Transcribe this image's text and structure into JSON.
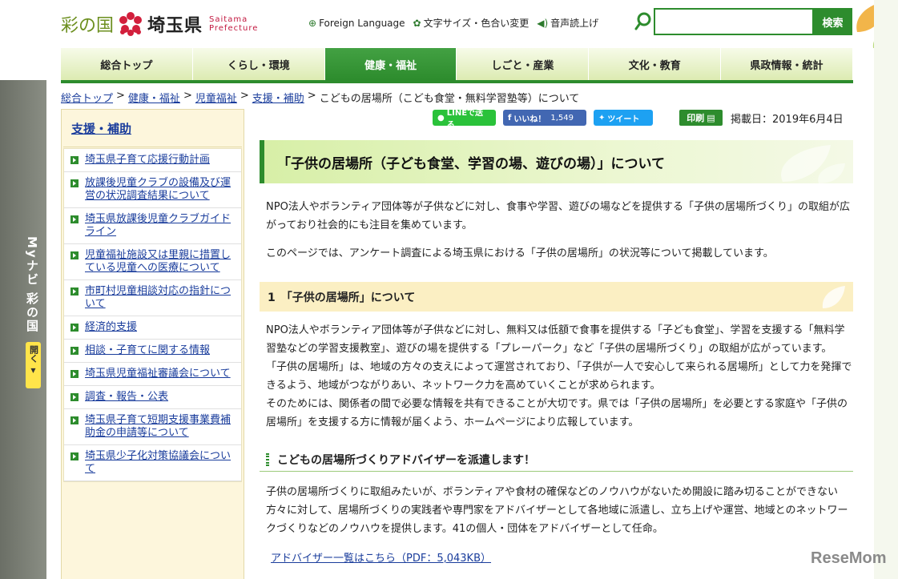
{
  "header": {
    "logo_irodori": "彩の国",
    "logo_pref": "埼玉県",
    "logo_en_line1": "Saitama",
    "logo_en_line2": "Prefecture",
    "util_links": [
      {
        "icon": "globe-icon",
        "label": "Foreign Language"
      },
      {
        "icon": "gear-icon",
        "label": "文字サイズ・色合い変更"
      },
      {
        "icon": "speaker-icon",
        "label": "音声読上げ"
      }
    ],
    "search_placeholder": "",
    "search_button": "検索"
  },
  "global_nav": [
    {
      "label": "総合トップ",
      "active": false
    },
    {
      "label": "くらし・環境",
      "active": false
    },
    {
      "label": "健康・福祉",
      "active": true
    },
    {
      "label": "しごと・産業",
      "active": false
    },
    {
      "label": "文化・教育",
      "active": false
    },
    {
      "label": "県政情報・統計",
      "active": false
    }
  ],
  "breadcrumb": {
    "links": [
      "総合トップ",
      "健康・福祉",
      "児童福祉",
      "支援・補助"
    ],
    "separator": ">",
    "current": "こどもの居場所（こども食堂・無料学習塾等）について"
  },
  "social": {
    "line": "LINEで送る",
    "like": "いいね！",
    "like_count": "1,549",
    "tweet": "ツイート",
    "print": "印刷",
    "pub_date": "掲載日：2019年6月4日"
  },
  "left_tab": {
    "label": "Myナビ 彩の国",
    "open": "開く"
  },
  "sidebar": {
    "title": "支援・補助",
    "items": [
      "埼玉県子育て応援行動計画",
      "放課後児童クラブの設備及び運営の状況調査結果について",
      "埼玉県放課後児童クラブガイドライン",
      "児童福祉施設又は里親に措置している児童への医療について",
      "市町村児童相談対応の指針について",
      "経済的支援",
      "相談・子育てに関する情報",
      "埼玉県児童福祉審議会について",
      "調査・報告・公表",
      "埼玉県子育て短期支援事業費補助金の申請等について",
      "埼玉県少子化対策協議会について"
    ]
  },
  "main": {
    "title": "「子供の居場所（子ども食堂、学習の場、遊びの場）」について",
    "intro1": "NPO法人やボランティア団体等が子供などに対し、食事や学習、遊びの場などを提供する「子供の居場所づくり」の取組が広がっており社会的にも注目を集めています。",
    "intro2": "このページでは、アンケート調査による埼玉県における「子供の居場所」の状況等について掲載しています。",
    "h2": "1　「子供の居場所」について",
    "section1_p1": "NPO法人やボランティア団体等が子供などに対し、無料又は低額で食事を提供する「子ども食堂」、学習を支援する「無料学習塾などの学習支援教室」、遊びの場を提供する「プレーパーク」など「子供の居場所づくり」の取組が広がっています。",
    "section1_p2": "「子供の居場所」は、地域の方々の支えによって運営されており、「子供が一人で安心して来られる居場所」として力を発揮できるよう、地域がつながりあい、ネットワーク力を高めていくことが求められます。",
    "section1_p3": "そのためには、関係者の間で必要な情報を共有できることが大切です。県では「子供の居場所」を必要とする家庭や「子供の居場所」を支援する方に情報が届くよう、ホームページにより広報しています。",
    "h3": "こどもの居場所づくりアドバイザーを派遣します！",
    "advisor_text": "子供の居場所づくりに取組みたいが、ボランティアや食材の確保などのノウハウがないため開設に踏み切ることができない方々に対して、居場所づくりの実践者や専門家をアドバイザーとして各地域に派遣し、立ち上げや運営、地域とのネットワークづくりなどのノウハウを提供します。41の個人・団体をアドバイザーとして任命。",
    "advisor_link": "アドバイザー一覧はこちら（PDF：5,043KB）"
  },
  "watermark": "ReseMom",
  "colors": {
    "brand_green": "#2d8c2d",
    "nav_bg": "#dcebb2",
    "sidebar_bg": "#fdf6dc",
    "link": "#1a3d9c"
  }
}
